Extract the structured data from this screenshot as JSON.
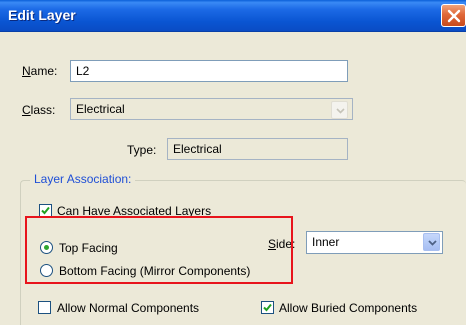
{
  "dialog": {
    "title": "Edit Layer"
  },
  "fields": {
    "name_label": "Name:",
    "name_value": "L2",
    "class_label": "Class:",
    "class_value": "Electrical",
    "type_label": "Type:",
    "type_value": "Electrical"
  },
  "layer_association": {
    "legend": "Layer Association:",
    "can_have_associated": {
      "label": "Can Have Associated Layers",
      "checked": true
    },
    "top_facing": {
      "label": "Top Facing",
      "selected": true
    },
    "bottom_facing": {
      "label": "Bottom Facing (Mirror Components)",
      "selected": false
    },
    "side_label": "Side:",
    "side_value": "Inner",
    "allow_normal": {
      "label": "Allow Normal Components",
      "checked": false
    },
    "allow_buried": {
      "label": "Allow Buried Components",
      "checked": true
    }
  },
  "icons": {
    "close": "close-icon",
    "dropdown": "chevron-down-icon",
    "check": "checkmark-icon"
  },
  "colors": {
    "titlebar": "#0a55d2",
    "close_button": "#e06838",
    "highlight": "#e8141c",
    "group_legend": "#1f4fd6",
    "radio_dot": "#2fa52f"
  }
}
